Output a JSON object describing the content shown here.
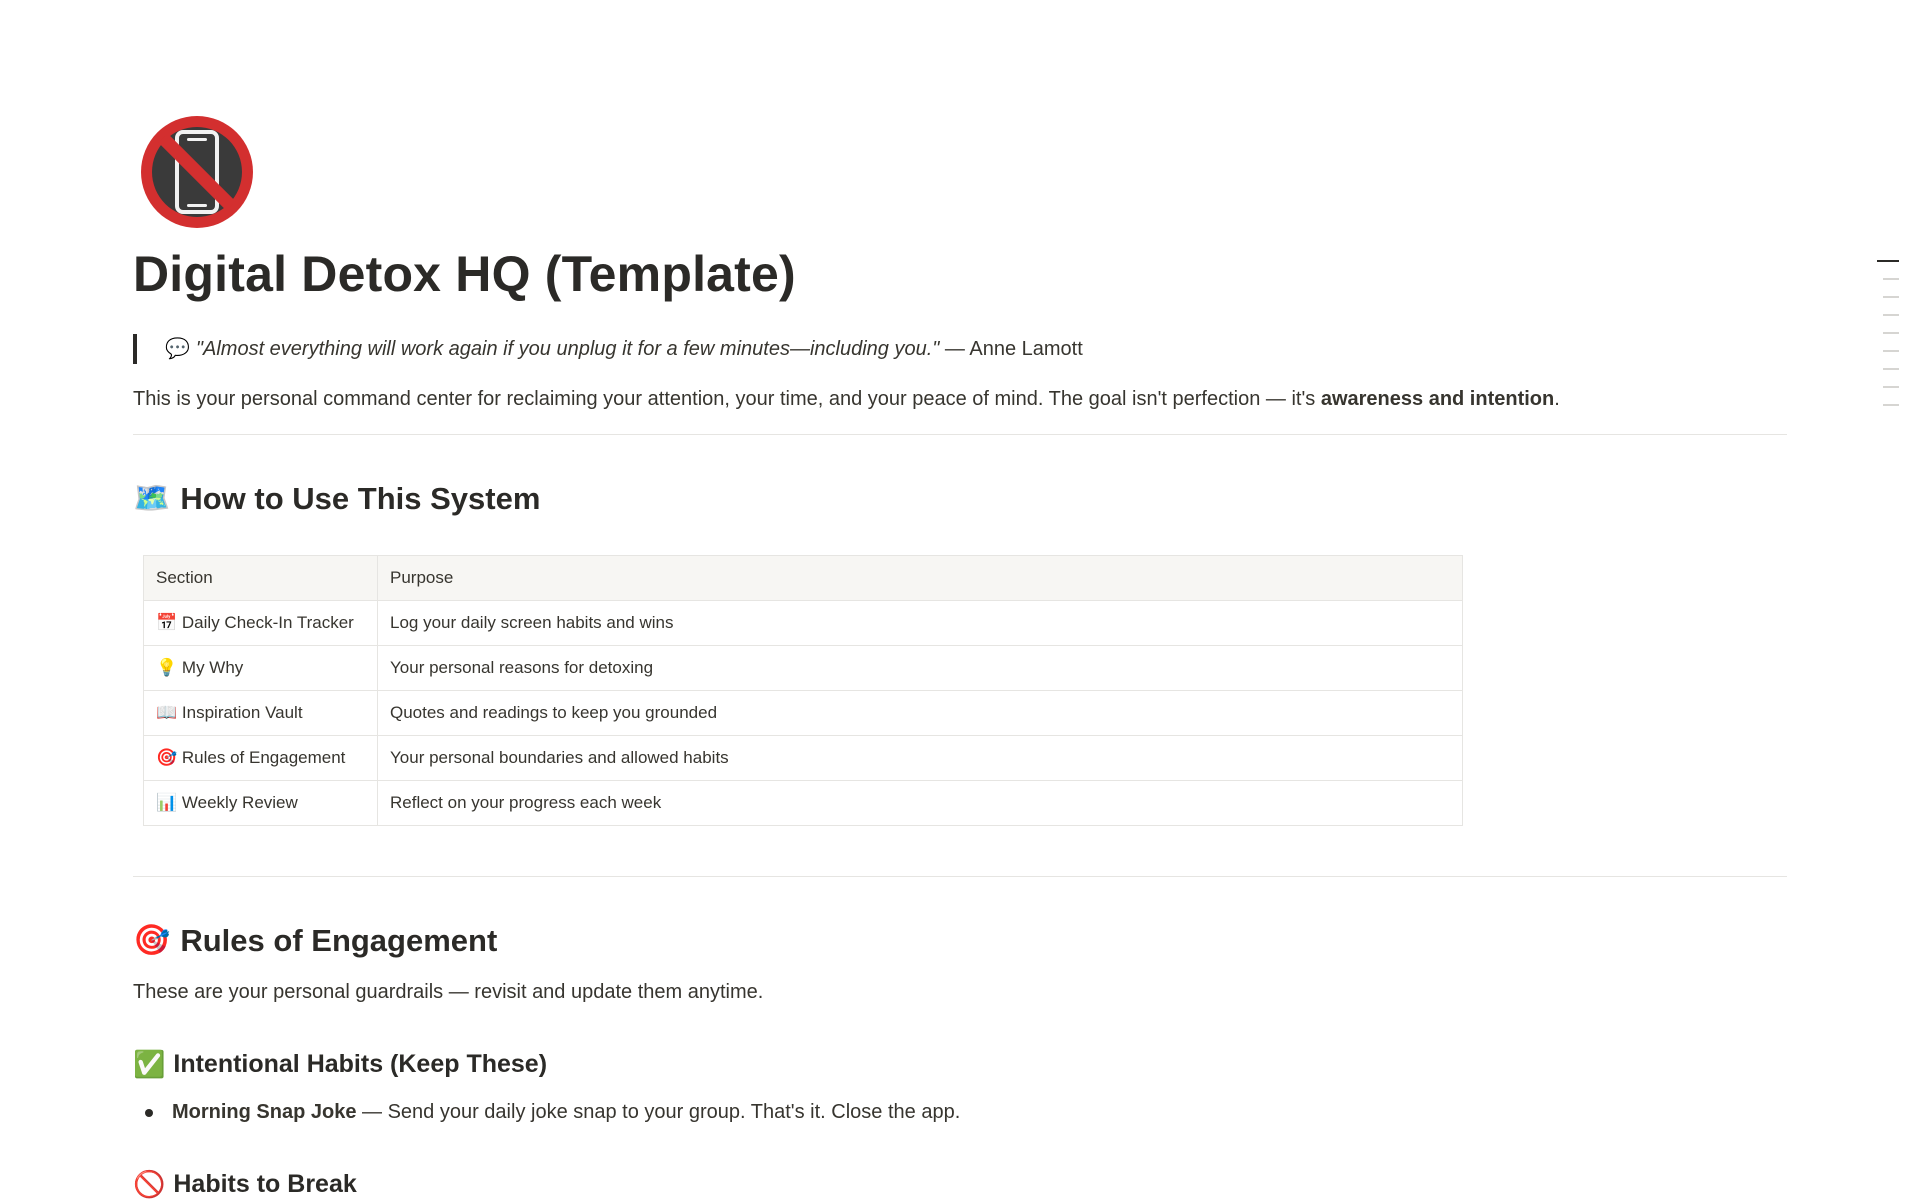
{
  "page": {
    "icon": "no-mobile-phones-icon",
    "title": "Digital Detox HQ (Template)"
  },
  "quote": {
    "emoji": "💬",
    "text": "\"Almost everything will work again if you unplug it for a few minutes—including you.\"",
    "attribution": " — Anne Lamott"
  },
  "intro": {
    "text": "This is your personal command center for reclaiming your attention, your time, and your peace of mind. The goal isn't perfection — it's ",
    "bold": "awareness and intention",
    "end": "."
  },
  "how_to_use": {
    "emoji": "🗺️",
    "heading": "How to Use This System",
    "table": {
      "headers": [
        "Section",
        "Purpose"
      ],
      "rows": [
        {
          "emoji": "📅",
          "section": "Daily Check-In Tracker",
          "purpose": "Log your daily screen habits and wins"
        },
        {
          "emoji": "💡",
          "section": "My Why",
          "purpose": "Your personal reasons for detoxing"
        },
        {
          "emoji": "📖",
          "section": "Inspiration Vault",
          "purpose": "Quotes and readings to keep you grounded"
        },
        {
          "emoji": "🎯",
          "section": "Rules of Engagement",
          "purpose": "Your personal boundaries and allowed habits"
        },
        {
          "emoji": "📊",
          "section": "Weekly Review",
          "purpose": "Reflect on your progress each week"
        }
      ]
    }
  },
  "rules": {
    "emoji": "🎯",
    "heading": "Rules of Engagement",
    "description": "These are your personal guardrails — revisit and update them anytime.",
    "intentional": {
      "emoji": "✅",
      "heading": "Intentional Habits (Keep These)",
      "items": [
        {
          "bold": "Morning Snap Joke",
          "text": " — Send your daily joke snap to your group. That's it. Close the app."
        }
      ]
    },
    "break": {
      "emoji": "🚫",
      "heading": "Habits to Break"
    }
  },
  "toc": {
    "active_index": 0,
    "count": 9
  }
}
